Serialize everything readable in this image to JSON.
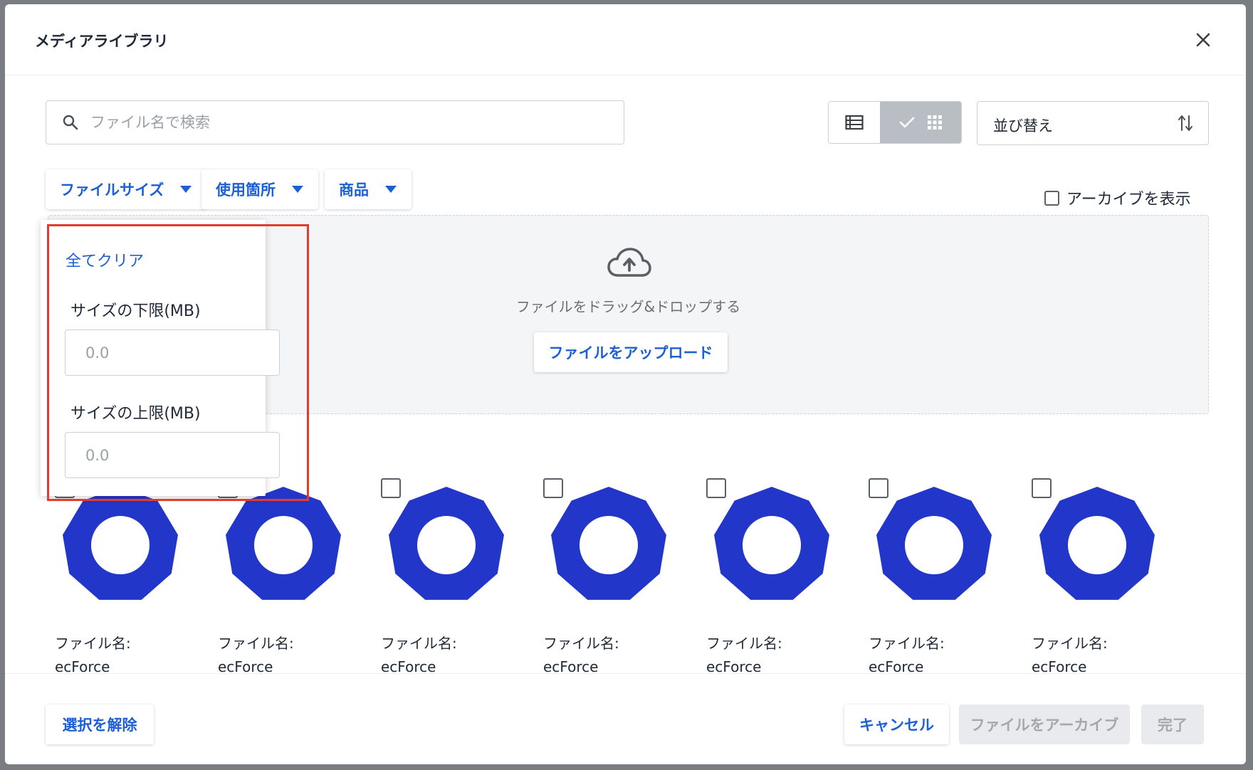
{
  "dialog": {
    "title": "メディアライブラリ"
  },
  "search": {
    "placeholder": "ファイル名で検索",
    "value": ""
  },
  "view_toggle": {
    "active": "grid"
  },
  "sort": {
    "label": "並び替え"
  },
  "filters": [
    {
      "label": "ファイルサイズ"
    },
    {
      "label": "使用箇所"
    },
    {
      "label": "商品"
    }
  ],
  "archive_toggle": {
    "label": "アーカイブを表示",
    "checked": false
  },
  "dropzone": {
    "hint": "ファイルをドラッグ&ドロップする",
    "upload_label": "ファイルをアップロード"
  },
  "size_filter": {
    "clear_label": "全てクリア",
    "min_label": "サイズの下限(MB)",
    "min_placeholder": "0.0",
    "max_label": "サイズの上限(MB)",
    "max_placeholder": "0.0"
  },
  "media": [
    {
      "name_label": "ファイル名:",
      "name": "ecForce",
      "checked": false
    },
    {
      "name_label": "ファイル名:",
      "name": "ecForce",
      "checked": false
    },
    {
      "name_label": "ファイル名:",
      "name": "ecForce",
      "checked": false
    },
    {
      "name_label": "ファイル名:",
      "name": "ecForce",
      "checked": false
    },
    {
      "name_label": "ファイル名:",
      "name": "ecForce",
      "checked": false
    },
    {
      "name_label": "ファイル名:",
      "name": "ecForce",
      "checked": false
    },
    {
      "name_label": "ファイル名:",
      "name": "ecForce",
      "checked": false
    }
  ],
  "footer": {
    "deselect_label": "選択を解除",
    "cancel_label": "キャンセル",
    "archive_label": "ファイルをアーカイブ",
    "done_label": "完了"
  },
  "colors": {
    "accent": "#1d5fd6",
    "thumbnail": "#2236c9",
    "highlight": "#e53b2c"
  }
}
